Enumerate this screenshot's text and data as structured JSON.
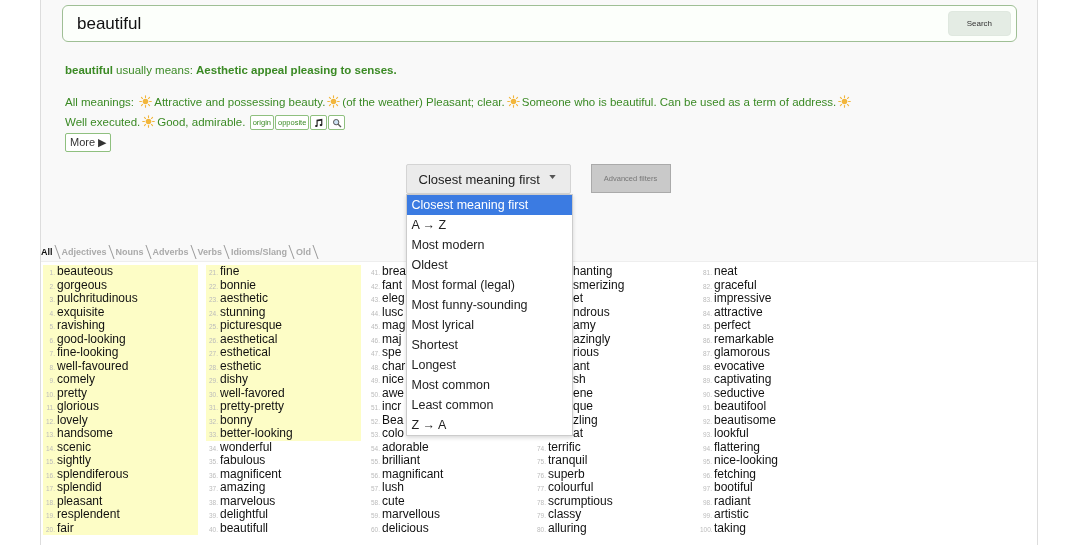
{
  "search": {
    "value": "beautiful",
    "button": "Search"
  },
  "summary": "**beautiful** usually means: **Aesthetic appeal pleasing to senses.**",
  "meanings": {
    "label": "All meanings:",
    "items": [
      "Attractive and possessing beauty.",
      "(of the weather) Pleasant; clear.",
      "Someone who is beautiful. Can be used as a term of address.",
      "Well executed.",
      "Good, admirable."
    ]
  },
  "tags": [
    {
      "kind": "text",
      "label": "origin"
    },
    {
      "kind": "text",
      "label": "opposite"
    },
    {
      "kind": "music"
    },
    {
      "kind": "search"
    }
  ],
  "more_button": "More ▶",
  "sort": {
    "value": "Closest meaning first",
    "expanded": true,
    "options": [
      {
        "label": "Closest meaning first",
        "selected": true
      },
      {
        "label": "A → Z",
        "selected": false
      },
      {
        "label": "Most modern",
        "selected": false
      },
      {
        "label": "Oldest",
        "selected": false
      },
      {
        "label": "Most formal (legal)",
        "selected": false
      },
      {
        "label": "Most funny-sounding",
        "selected": false
      },
      {
        "label": "Most lyrical",
        "selected": false
      },
      {
        "label": "Shortest",
        "selected": false
      },
      {
        "label": "Longest",
        "selected": false
      },
      {
        "label": "Most common",
        "selected": false
      },
      {
        "label": "Least common",
        "selected": false
      },
      {
        "label": "Z → A",
        "selected": false
      }
    ]
  },
  "advanced_button": {
    "label": "Advanced filters",
    "disabled": true
  },
  "tabs": [
    {
      "label": "All",
      "selected": true
    },
    {
      "label": "Adjectives",
      "selected": false
    },
    {
      "label": "Nouns",
      "selected": false
    },
    {
      "label": "Adverbs",
      "selected": false
    },
    {
      "label": "Verbs",
      "selected": false
    },
    {
      "label": "Idioms/Slang",
      "selected": false
    },
    {
      "label": "Old",
      "selected": false
    }
  ],
  "columns": [
    {
      "items": [
        {
          "num": "1.",
          "word": "beauteous",
          "highlighted": true
        },
        {
          "num": "2.",
          "word": "gorgeous",
          "highlighted": true
        },
        {
          "num": "3.",
          "word": "pulchritudinous",
          "highlighted": true
        },
        {
          "num": "4.",
          "word": "exquisite",
          "highlighted": true
        },
        {
          "num": "5.",
          "word": "ravishing",
          "highlighted": true
        },
        {
          "num": "6.",
          "word": "good-looking",
          "highlighted": true
        },
        {
          "num": "7.",
          "word": "fine-looking",
          "highlighted": true
        },
        {
          "num": "8.",
          "word": "well-favoured",
          "highlighted": true
        },
        {
          "num": "9.",
          "word": "comely",
          "highlighted": true
        },
        {
          "num": "10.",
          "word": "pretty",
          "highlighted": true
        },
        {
          "num": "11.",
          "word": "glorious",
          "highlighted": true
        },
        {
          "num": "12.",
          "word": "lovely",
          "highlighted": true
        },
        {
          "num": "13.",
          "word": "handsome",
          "highlighted": true
        },
        {
          "num": "14.",
          "word": "scenic",
          "highlighted": true
        },
        {
          "num": "15.",
          "word": "sightly",
          "highlighted": true
        },
        {
          "num": "16.",
          "word": "splendiferous",
          "highlighted": true
        },
        {
          "num": "17.",
          "word": "splendid",
          "highlighted": true
        },
        {
          "num": "18.",
          "word": "pleasant",
          "highlighted": true
        },
        {
          "num": "19.",
          "word": "resplendent",
          "highlighted": true
        },
        {
          "num": "20.",
          "word": "fair",
          "highlighted": true
        }
      ]
    },
    {
      "items": [
        {
          "num": "21.",
          "word": "fine",
          "highlighted": true
        },
        {
          "num": "22.",
          "word": "bonnie",
          "highlighted": true
        },
        {
          "num": "23.",
          "word": "aesthetic",
          "highlighted": true
        },
        {
          "num": "24.",
          "word": "stunning",
          "highlighted": true
        },
        {
          "num": "25.",
          "word": "picturesque",
          "highlighted": true
        },
        {
          "num": "26.",
          "word": "aesthetical",
          "highlighted": true
        },
        {
          "num": "27.",
          "word": "esthetical",
          "highlighted": true
        },
        {
          "num": "28.",
          "word": "esthetic",
          "highlighted": true
        },
        {
          "num": "29.",
          "word": "dishy",
          "highlighted": true
        },
        {
          "num": "30.",
          "word": "well-favored",
          "highlighted": true
        },
        {
          "num": "31.",
          "word": "pretty-pretty",
          "highlighted": true
        },
        {
          "num": "32.",
          "word": "bonny",
          "highlighted": true
        },
        {
          "num": "33.",
          "word": "better-looking",
          "highlighted": true
        },
        {
          "num": "34.",
          "word": "wonderful",
          "highlighted": false
        },
        {
          "num": "35.",
          "word": "fabulous",
          "highlighted": false
        },
        {
          "num": "36.",
          "word": "magnificent",
          "highlighted": false
        },
        {
          "num": "37.",
          "word": "amazing",
          "highlighted": false
        },
        {
          "num": "38.",
          "word": "marvelous",
          "highlighted": false
        },
        {
          "num": "39.",
          "word": "delightful",
          "highlighted": false
        },
        {
          "num": "40.",
          "word": "beautifull",
          "highlighted": false
        }
      ]
    },
    {
      "items": [
        {
          "num": "41.",
          "word": "brea",
          "highlighted": false
        },
        {
          "num": "42.",
          "word": "fant",
          "highlighted": false
        },
        {
          "num": "43.",
          "word": "eleg",
          "highlighted": false
        },
        {
          "num": "44.",
          "word": "lusc",
          "highlighted": false
        },
        {
          "num": "45.",
          "word": "mag",
          "highlighted": false
        },
        {
          "num": "46.",
          "word": "maj",
          "highlighted": false
        },
        {
          "num": "47.",
          "word": "spe",
          "highlighted": false
        },
        {
          "num": "48.",
          "word": "char",
          "highlighted": false
        },
        {
          "num": "49.",
          "word": "nice",
          "highlighted": false
        },
        {
          "num": "50.",
          "word": "awe",
          "highlighted": false
        },
        {
          "num": "51.",
          "word": "incr",
          "highlighted": false
        },
        {
          "num": "52.",
          "word": "Bea",
          "highlighted": false
        },
        {
          "num": "53.",
          "word": "colo",
          "highlighted": false
        },
        {
          "num": "54.",
          "word": "adorable",
          "highlighted": false
        },
        {
          "num": "55.",
          "word": "brilliant",
          "highlighted": false
        },
        {
          "num": "56.",
          "word": "magnificant",
          "highlighted": false
        },
        {
          "num": "57.",
          "word": "lush",
          "highlighted": false
        },
        {
          "num": "58.",
          "word": "cute",
          "highlighted": false
        },
        {
          "num": "59.",
          "word": "marvellous",
          "highlighted": false
        },
        {
          "num": "60.",
          "word": "delicious",
          "highlighted": false
        }
      ]
    },
    {
      "items": [
        {
          "word": "hanting",
          "highlighted": false
        },
        {
          "word": "smerizing",
          "highlighted": false
        },
        {
          "word": "et",
          "highlighted": false
        },
        {
          "word": "ndrous",
          "highlighted": false
        },
        {
          "word": "amy",
          "highlighted": false
        },
        {
          "word": "azingly",
          "highlighted": false
        },
        {
          "word": "rious",
          "highlighted": false
        },
        {
          "word": "ant",
          "highlighted": false
        },
        {
          "word": "sh",
          "highlighted": false
        },
        {
          "word": "ene",
          "highlighted": false
        },
        {
          "word": "que",
          "highlighted": false
        },
        {
          "word": "zling",
          "highlighted": false
        },
        {
          "word": "at",
          "highlighted": false
        },
        {
          "num": "74.",
          "word": "terrific",
          "highlighted": false
        },
        {
          "num": "75.",
          "word": "tranquil",
          "highlighted": false
        },
        {
          "num": "76.",
          "word": "superb",
          "highlighted": false
        },
        {
          "num": "77.",
          "word": "colourful",
          "highlighted": false
        },
        {
          "num": "78.",
          "word": "scrumptious",
          "highlighted": false
        },
        {
          "num": "79.",
          "word": "classy",
          "highlighted": false
        },
        {
          "num": "80.",
          "word": "alluring",
          "highlighted": false
        }
      ]
    },
    {
      "items": [
        {
          "num": "81.",
          "word": "neat",
          "highlighted": false
        },
        {
          "num": "82.",
          "word": "graceful",
          "highlighted": false
        },
        {
          "num": "83.",
          "word": "impressive",
          "highlighted": false
        },
        {
          "num": "84.",
          "word": "attractive",
          "highlighted": false
        },
        {
          "num": "85.",
          "word": "perfect",
          "highlighted": false
        },
        {
          "num": "86.",
          "word": "remarkable",
          "highlighted": false
        },
        {
          "num": "87.",
          "word": "glamorous",
          "highlighted": false
        },
        {
          "num": "88.",
          "word": "evocative",
          "highlighted": false
        },
        {
          "num": "89.",
          "word": "captivating",
          "highlighted": false
        },
        {
          "num": "90.",
          "word": "seductive",
          "highlighted": false
        },
        {
          "num": "91.",
          "word": "beautifool",
          "highlighted": false
        },
        {
          "num": "92.",
          "word": "beautisome",
          "highlighted": false
        },
        {
          "num": "93.",
          "word": "lookful",
          "highlighted": false
        },
        {
          "num": "94.",
          "word": "flattering",
          "highlighted": false
        },
        {
          "num": "95.",
          "word": "nice-looking",
          "highlighted": false
        },
        {
          "num": "96.",
          "word": "fetching",
          "highlighted": false
        },
        {
          "num": "97.",
          "word": "bootiful",
          "highlighted": false
        },
        {
          "num": "98.",
          "word": "radiant",
          "highlighted": false
        },
        {
          "num": "99.",
          "word": "artistic",
          "highlighted": false
        },
        {
          "num": "100.",
          "word": "taking",
          "highlighted": false
        }
      ]
    }
  ]
}
